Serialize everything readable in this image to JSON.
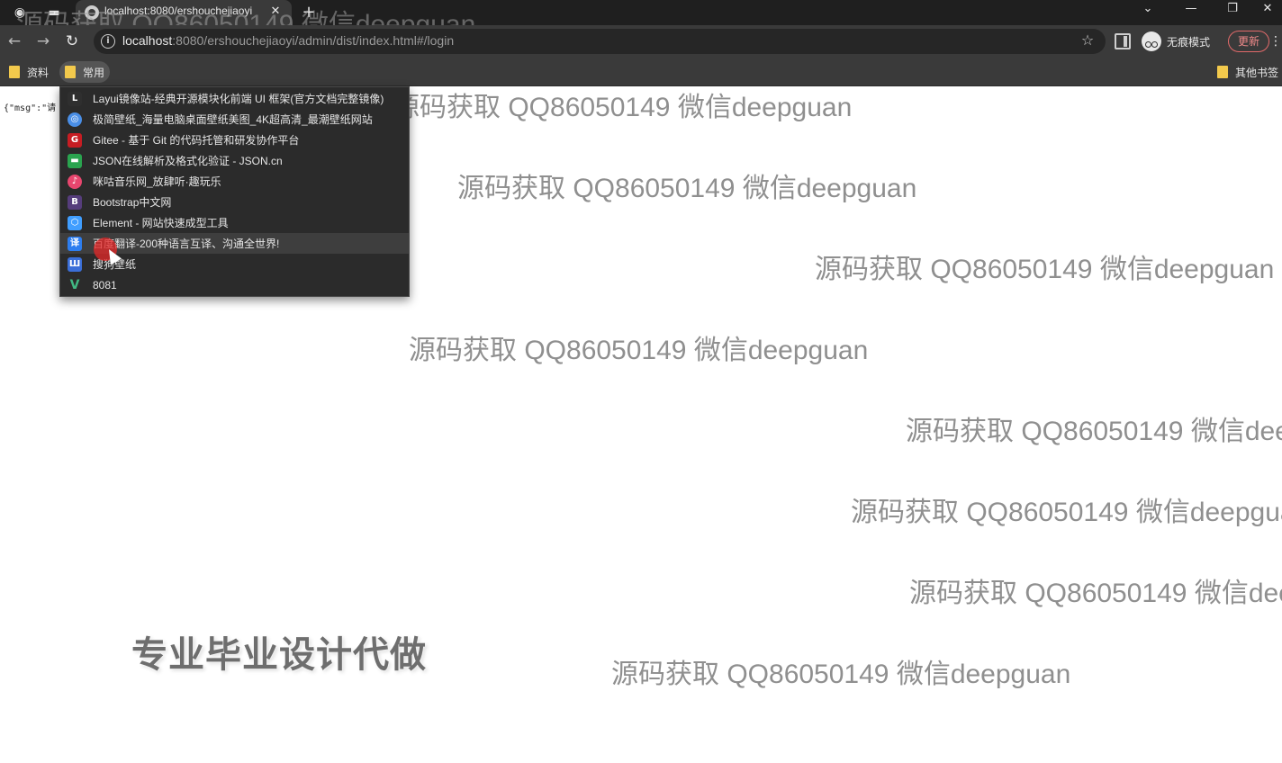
{
  "tabs": {
    "active_title": "localhost:8080/ershouchejiaoyi",
    "close_glyph": "✕",
    "new_tab_glyph": "+"
  },
  "window_controls": {
    "dropdown_glyph": "⌄",
    "minimize_glyph": "—",
    "restore_glyph": "❐",
    "close_glyph": "✕"
  },
  "toolbar": {
    "back_glyph": "←",
    "forward_glyph": "→",
    "reload_glyph": "↻",
    "url_host": "localhost",
    "url_path": ":8080/ershouchejiaoyi/admin/dist/index.html#/login",
    "incognito_label": "无痕模式",
    "update_label": "更新",
    "menu_glyph": "⋮",
    "star_glyph": "☆"
  },
  "bookmarks": {
    "items": [
      {
        "label": "资料"
      },
      {
        "label": "常用"
      }
    ],
    "other_label": "其他书签"
  },
  "dropdown": {
    "items": [
      {
        "label": "Layui镜像站-经典开源模块化前端 UI 框架(官方文档完整镜像)",
        "icon": "layui-icon",
        "glyph": "L",
        "color": "#2f2f2f"
      },
      {
        "label": "极简壁纸_海量电脑桌面壁纸美图_4K超高清_最潮壁纸网站",
        "icon": "wallpaper-icon",
        "glyph": "◎",
        "color": "#4a8fe7"
      },
      {
        "label": "Gitee - 基于 Git 的代码托管和研发协作平台",
        "icon": "gitee-icon",
        "glyph": "G",
        "color": "#c71d23"
      },
      {
        "label": "JSON在线解析及格式化验证 - JSON.cn",
        "icon": "json-icon",
        "glyph": "▬",
        "color": "#2aa44f"
      },
      {
        "label": "咪咕音乐网_放肆听·趣玩乐",
        "icon": "migu-icon",
        "glyph": "♪",
        "color": "#e8466e"
      },
      {
        "label": "Bootstrap中文网",
        "icon": "bootstrap-icon",
        "glyph": "B",
        "color": "#563d7c"
      },
      {
        "label": "Element - 网站快速成型工具",
        "icon": "element-icon",
        "glyph": "⬡",
        "color": "#409eff"
      },
      {
        "label": "百度翻译-200种语言互译、沟通全世界!",
        "icon": "baidu-translate-icon",
        "glyph": "译",
        "color": "#2d7ef0"
      },
      {
        "label": "搜狗壁纸",
        "icon": "sogou-wallpaper-icon",
        "glyph": "Ш",
        "color": "#3b6fd8"
      },
      {
        "label": "8081",
        "icon": "vue-icon",
        "glyph": "V",
        "color": "#41b883"
      }
    ]
  },
  "page": {
    "json_text": "{\"msg\":\"请",
    "watermark": "源码获取 QQ86050149 微信deepguan",
    "promo": "专业毕业设计代做"
  }
}
